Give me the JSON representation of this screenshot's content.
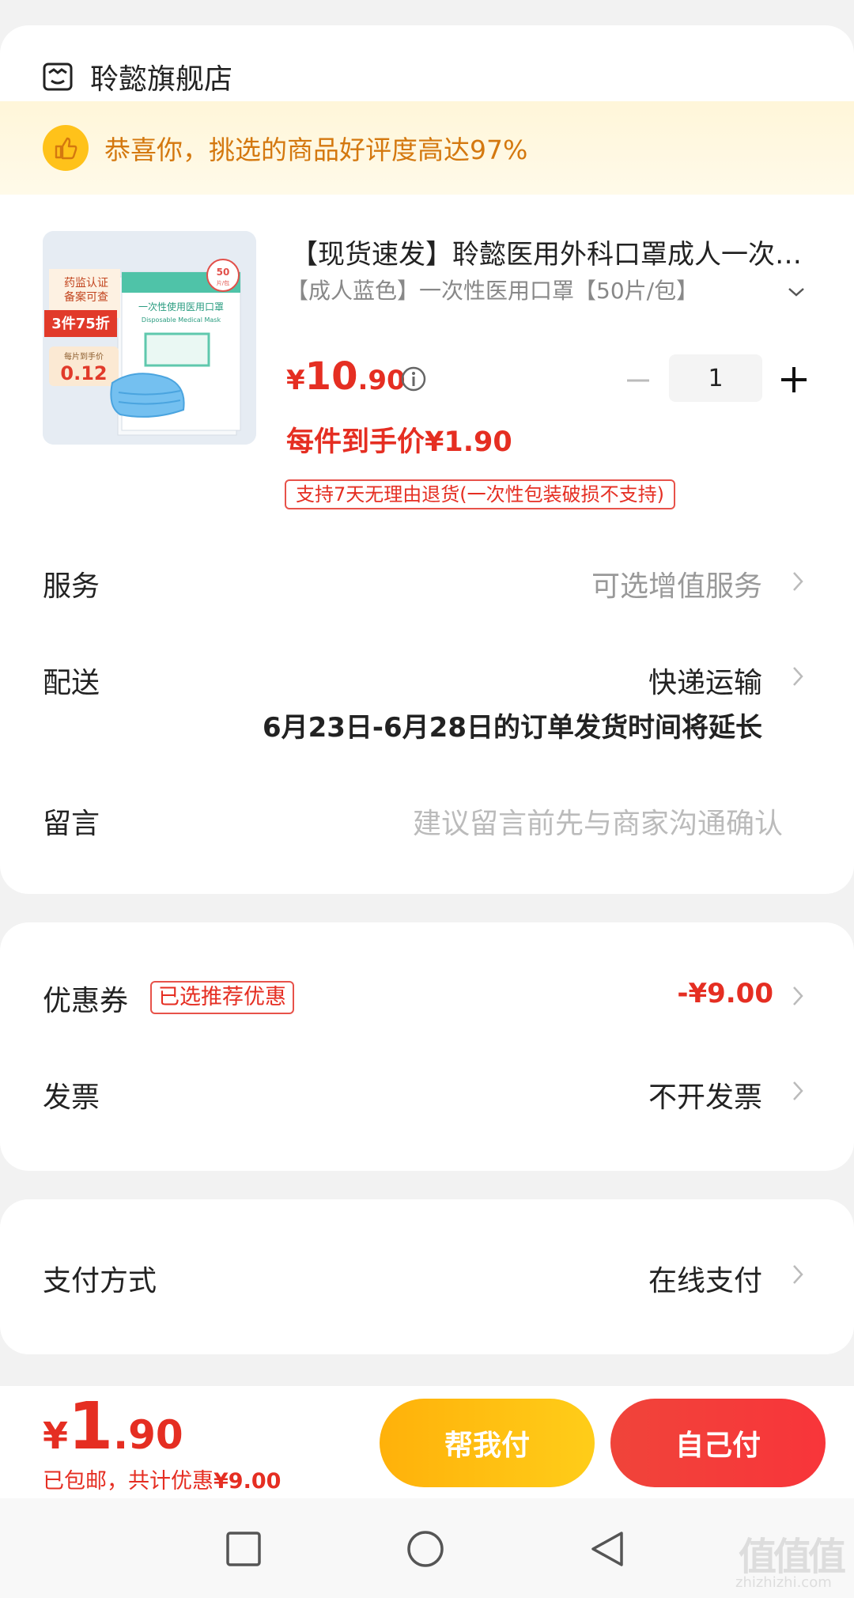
{
  "store": {
    "name": "聆懿旗舰店",
    "icon": "store-icon"
  },
  "banner": {
    "text": "恭喜你，挑选的商品好评度高达97%",
    "icon": "thumbs-up-icon"
  },
  "product": {
    "title": "【现货速发】聆懿医用外科口罩成人一次性医用口罩",
    "spec": "【成人蓝色】一次性医用口罩【50片/包】",
    "price_symbol": "¥",
    "price_int": "10",
    "price_dec": ".90",
    "unit_price_label": "每件到手价¥1.90",
    "quantity": "1",
    "return_policy": "支持7天无理由退货(一次性包装破损不支持)",
    "image_texts": {
      "cert": "药监认证",
      "cert2": "备案可查",
      "promo": "3件75折",
      "unit_label": "每片到手价",
      "unit_value": "0.12",
      "pack_count": "50",
      "pack_unit": "片/包",
      "pack_title": "一次性使用医用口罩",
      "pack_subtitle": "Disposable Medical Mask"
    }
  },
  "rows": {
    "service": {
      "label": "服务",
      "value": "可选增值服务"
    },
    "delivery": {
      "label": "配送",
      "value": "快递运输",
      "note": "6月23日-6月28日的订单发货时间将延长"
    },
    "message": {
      "label": "留言",
      "placeholder": "建议留言前先与商家沟通确认"
    },
    "coupon": {
      "label": "优惠券",
      "tag": "已选推荐优惠",
      "value": "-¥9.00"
    },
    "invoice": {
      "label": "发票",
      "value": "不开发票"
    },
    "payment": {
      "label": "支付方式",
      "value": "在线支付"
    }
  },
  "footer": {
    "total_symbol": "¥",
    "total_int": "1",
    "total_dec": ".90",
    "note_prefix": "已包邮，共计优惠",
    "note_amount": "¥9.00",
    "help_pay": "帮我付",
    "self_pay": "自己付"
  },
  "watermark": {
    "text": "值值值",
    "url": "zhizhizhi.com"
  },
  "colors": {
    "accent": "#e52e22",
    "banner_text": "#d4780f",
    "help_button": "#ffb10a",
    "self_button": "#f0443a"
  }
}
